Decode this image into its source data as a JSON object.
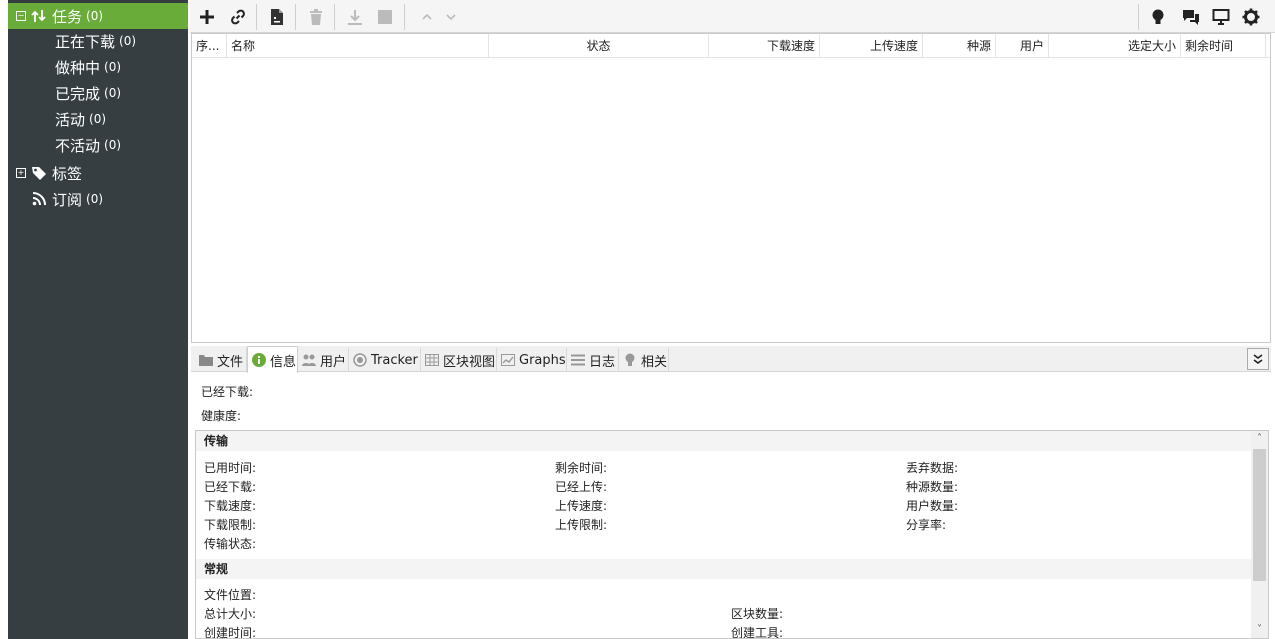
{
  "sidebar": {
    "items": [
      {
        "label": "任务",
        "count": "(0)",
        "expander": "−"
      },
      {
        "label": "正在下载",
        "count": "(0)"
      },
      {
        "label": "做种中",
        "count": "(0)"
      },
      {
        "label": "已完成",
        "count": "(0)"
      },
      {
        "label": "活动",
        "count": "(0)"
      },
      {
        "label": "不活动",
        "count": "(0)"
      },
      {
        "label": "标签",
        "count": "",
        "expander": "+"
      },
      {
        "label": "订阅",
        "count": "(0)"
      }
    ]
  },
  "table": {
    "columns": [
      "序...",
      "名称",
      "状态",
      "下载速度",
      "上传速度",
      "种源",
      "用户",
      "选定大小",
      "剩余时间"
    ]
  },
  "tabs": [
    "文件",
    "信息",
    "用户",
    "Tracker",
    "区块视图",
    "Graphs",
    "日志",
    "相关"
  ],
  "info": {
    "downloaded_label": "已经下载:",
    "health_label": "健康度:",
    "transfer": {
      "title": "传输",
      "col1": [
        "已用时间:",
        "已经下载:",
        "下载速度:",
        "下载限制:",
        "传输状态:"
      ],
      "col2": [
        "剩余时间:",
        "已经上传:",
        "上传速度:",
        "上传限制:"
      ],
      "col3": [
        "丢弃数据:",
        "种源数量:",
        "用户数量:",
        "分享率:"
      ]
    },
    "general": {
      "title": "常规",
      "col1": [
        "文件位置:",
        "总计大小:",
        "创建时间:"
      ],
      "col2": [
        "区块数量:",
        "创建工具:"
      ]
    }
  },
  "colors": {
    "sidebar_bg": "#363e41",
    "selected_bg": "#6aac3a"
  }
}
